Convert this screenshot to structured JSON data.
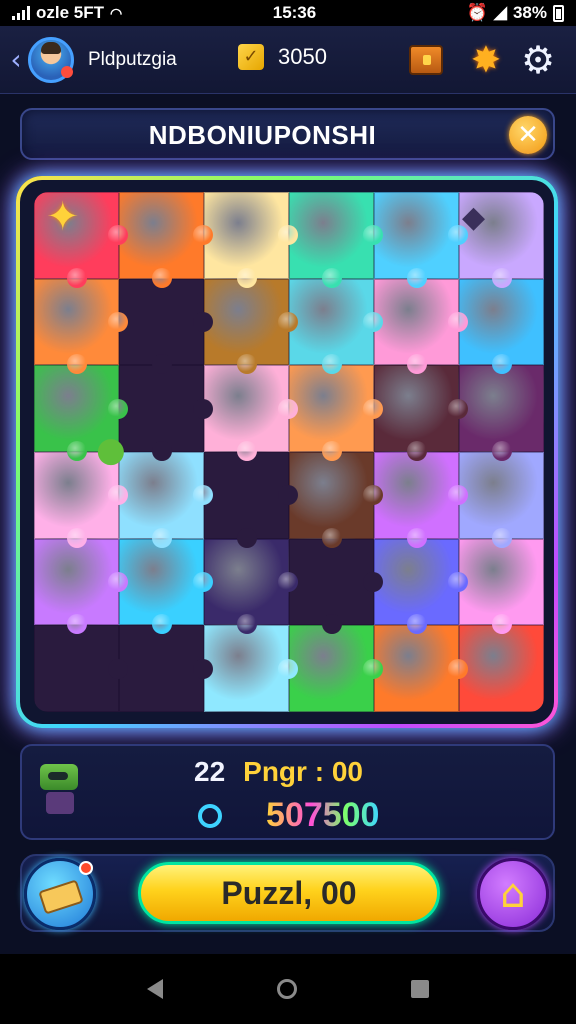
{
  "status_bar": {
    "carrier": "ozle 5FT",
    "time": "15:36",
    "battery": "38%"
  },
  "top_bar": {
    "username": "Pldputzgia",
    "coins": "3050",
    "coin_icon_glyph": "✓"
  },
  "title_bar": {
    "title": "NDBONIUPONSHI",
    "close_glyph": "✕"
  },
  "board": {
    "rows": 6,
    "cols": 6,
    "piece_colors": [
      "#ff3d5c",
      "#ff7a2a",
      "#ffe6a0",
      "#38e0b0",
      "#4fd0ff",
      "#c9a8ff",
      "#ff8a3a",
      "#2c2f7a",
      "#b87a2a",
      "#5ad8e8",
      "#ff9ad8",
      "#3fc0ff",
      "#39c24a",
      "#2a1b3e",
      "#ffb0d8",
      "#ff9a50",
      "#5a2a3a",
      "#6a2a6a",
      "#ffb0e8",
      "#8fe0ff",
      "#3a1a3a",
      "#6a3a2a",
      "#d070ff",
      "#a0a8ff",
      "#c87aff",
      "#3ad0ff",
      "#3a2a6a",
      "#2a1b3e",
      "#6a6aff",
      "#ff9af0",
      "#4a2a5a",
      "#2a1b3e",
      "#8fe8ff",
      "#3ad04a",
      "#ff7a2a",
      "#ff4a3a"
    ],
    "dark_pieces": [
      7,
      13,
      20,
      27,
      30,
      31
    ]
  },
  "info_panel": {
    "level_number": "22",
    "level_label": "Pngr : 00",
    "score": "507500"
  },
  "bottom_bar": {
    "play_label": "Puzzl, 00",
    "home_glyph": "⌂"
  },
  "icons": {
    "back": "chevron-left-icon",
    "chest": "treasure-chest-icon",
    "star": "star-badge-icon",
    "gear": "gear-icon",
    "map": "map-scroll-icon",
    "home": "home-icon"
  }
}
